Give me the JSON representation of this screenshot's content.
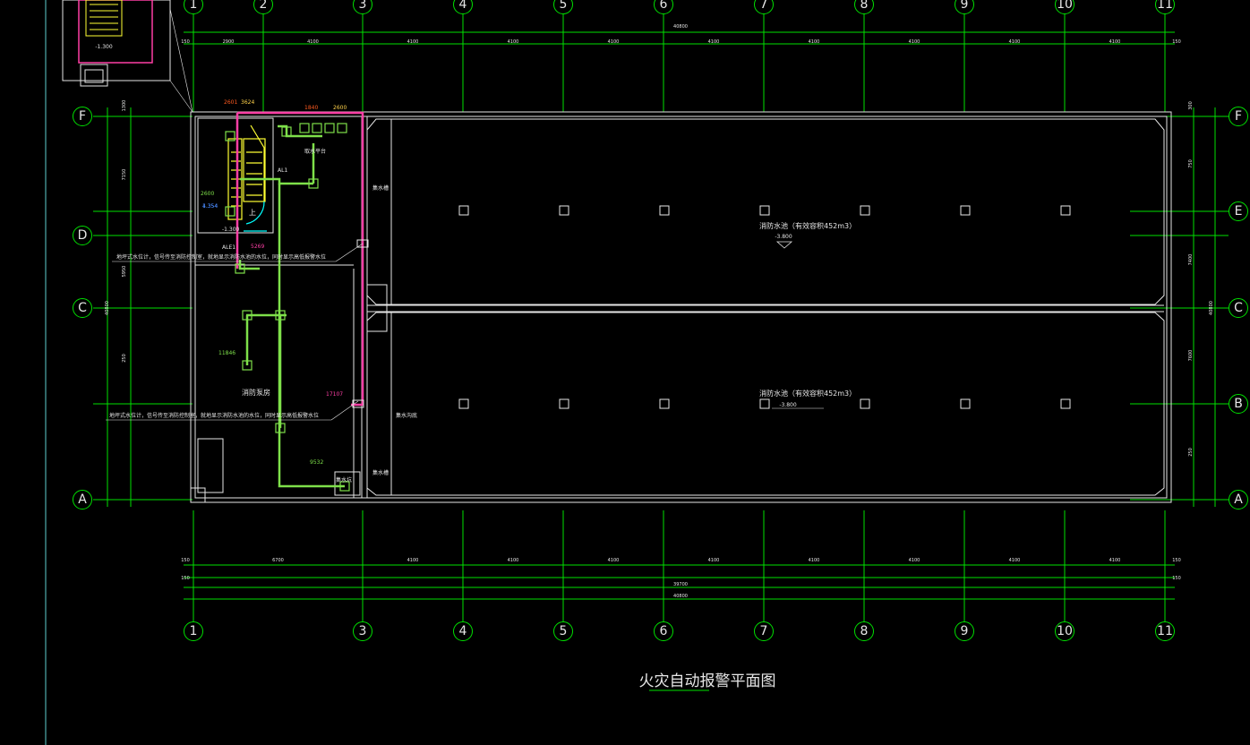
{
  "drawing": {
    "title": "火灾自动报警平面图",
    "colors": {
      "background": "#000000",
      "grid": "#00e000",
      "wall": "#e6e6e6",
      "fire_cable": "#ff3fa6",
      "signal_cable": "#7ee04a",
      "stair": "#ffff33",
      "title_underline": "#00e000"
    },
    "axes": {
      "columns": [
        "1",
        "2",
        "3",
        "4",
        "5",
        "6",
        "7",
        "8",
        "9",
        "10",
        "11"
      ],
      "rows": [
        "F",
        "E",
        "D",
        "C",
        "B",
        "A"
      ]
    },
    "dimensions": {
      "overall": "40800",
      "inner": "39700",
      "top_segments": [
        "2900",
        "4100",
        "4100",
        "4100",
        "4100",
        "4100",
        "4100",
        "4100",
        "4100",
        "4100"
      ],
      "bottom_segments": [
        "6700",
        "4100",
        "4100",
        "4100",
        "4100",
        "4100",
        "4100",
        "4100",
        "4100"
      ],
      "edge": "150",
      "left_bays": [
        "1300",
        "7150",
        "5950",
        "250"
      ],
      "right_bays": [
        "300",
        "750",
        "7400",
        "7600",
        "250"
      ]
    },
    "rooms": {
      "pump_room": "消防泵房",
      "tank_north": "消防水池（有效容积452m3）",
      "tank_south": "消防水池（有效容积452m3）",
      "tank_level": "-3.800",
      "inspection_well_top": "集水槽",
      "inspection_well_bottom": "集水槽",
      "sump_trench": "集水沟底",
      "top_platform": "取水平台",
      "drain_pit": "集水坑",
      "stair_up": "上",
      "alarm_box": "AL1",
      "alarm_box_lower": "ALE1",
      "tank_label": "-1.300",
      "stair_level": "-1.300",
      "stair_mark": "1.354"
    },
    "notes": {
      "note1": "地坪式水位计，信号传至消防控制室，就地显示消防水池的水位，同时显示高低报警水位",
      "note2": "地坪式水位计，信号传至消防控制室，就地显示消防水池的水位，同时显示高低报警水位"
    },
    "tags": {
      "t1": "2601",
      "t2": "3624",
      "t3": "2600",
      "t4": "4.354",
      "t5": "5269",
      "t6": "11846",
      "t7": "17107",
      "t8": "9532",
      "t9": "1840",
      "t10": "2600"
    }
  }
}
